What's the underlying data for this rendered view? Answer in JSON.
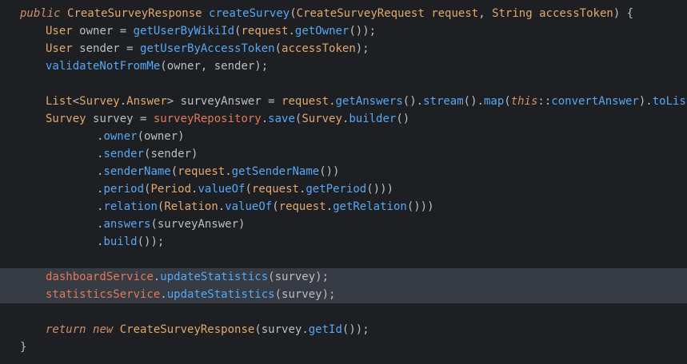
{
  "editor": {
    "lines": [
      {
        "segs": [
          [
            "public ",
            "kw"
          ],
          [
            "CreateSurveyResponse ",
            "cls"
          ],
          [
            "createSurvey",
            "fn"
          ],
          [
            "(",
            "var"
          ],
          [
            "CreateSurveyRequest ",
            "cls"
          ],
          [
            "request",
            "par"
          ],
          [
            ", ",
            "var"
          ],
          [
            "String ",
            "cls"
          ],
          [
            "accessToken",
            "par"
          ],
          [
            ") {",
            "var"
          ]
        ]
      },
      {
        "segs": [
          [
            "User ",
            "cls"
          ],
          [
            "owner = ",
            "var"
          ],
          [
            "getUserByWikiId",
            "fn"
          ],
          [
            "(",
            "var"
          ],
          [
            "request",
            "par"
          ],
          [
            ".",
            "var"
          ],
          [
            "getOwner",
            "fn"
          ],
          [
            "());",
            "var"
          ]
        ]
      },
      {
        "segs": [
          [
            "User ",
            "cls"
          ],
          [
            "sender = ",
            "var"
          ],
          [
            "getUserByAccessToken",
            "fn"
          ],
          [
            "(",
            "var"
          ],
          [
            "accessToken",
            "par"
          ],
          [
            ");",
            "var"
          ]
        ]
      },
      {
        "segs": [
          [
            "validateNotFromMe",
            "fn"
          ],
          [
            "(owner, sender);",
            "var"
          ]
        ]
      },
      {
        "segs": []
      },
      {
        "segs": [
          [
            "List",
            "cls"
          ],
          [
            "<",
            "var"
          ],
          [
            "Survey",
            "cls"
          ],
          [
            ".",
            "var"
          ],
          [
            "Answer",
            "cls"
          ],
          [
            "> surveyAnswer = ",
            "var"
          ],
          [
            "request",
            "par"
          ],
          [
            ".",
            "var"
          ],
          [
            "getAnswers",
            "fn"
          ],
          [
            "().",
            "var"
          ],
          [
            "stream",
            "fn"
          ],
          [
            "().",
            "var"
          ],
          [
            "map",
            "fn"
          ],
          [
            "(",
            "var"
          ],
          [
            "this",
            "this"
          ],
          [
            "::",
            "var"
          ],
          [
            "convertAnswer",
            "fn"
          ],
          [
            ").",
            "var"
          ],
          [
            "toList",
            "fn"
          ],
          [
            "();",
            "var"
          ]
        ]
      },
      {
        "segs": [
          [
            "Survey ",
            "cls"
          ],
          [
            "survey = ",
            "var"
          ],
          [
            "surveyRepository",
            "red"
          ],
          [
            ".",
            "var"
          ],
          [
            "save",
            "fn"
          ],
          [
            "(",
            "var"
          ],
          [
            "Survey",
            "cls"
          ],
          [
            ".",
            "var"
          ],
          [
            "builder",
            "fn"
          ],
          [
            "()",
            "var"
          ]
        ]
      },
      {
        "segs": [
          [
            ".",
            "var"
          ],
          [
            "owner",
            "fn"
          ],
          [
            "(owner)",
            "var"
          ]
        ]
      },
      {
        "segs": [
          [
            ".",
            "var"
          ],
          [
            "sender",
            "fn"
          ],
          [
            "(sender)",
            "var"
          ]
        ]
      },
      {
        "segs": [
          [
            ".",
            "var"
          ],
          [
            "senderName",
            "fn"
          ],
          [
            "(",
            "var"
          ],
          [
            "request",
            "par"
          ],
          [
            ".",
            "var"
          ],
          [
            "getSenderName",
            "fn"
          ],
          [
            "())",
            "var"
          ]
        ]
      },
      {
        "segs": [
          [
            ".",
            "var"
          ],
          [
            "period",
            "fn"
          ],
          [
            "(",
            "var"
          ],
          [
            "Period",
            "cls"
          ],
          [
            ".",
            "var"
          ],
          [
            "valueOf",
            "fn"
          ],
          [
            "(",
            "var"
          ],
          [
            "request",
            "par"
          ],
          [
            ".",
            "var"
          ],
          [
            "getPeriod",
            "fn"
          ],
          [
            "()))",
            "var"
          ]
        ]
      },
      {
        "segs": [
          [
            ".",
            "var"
          ],
          [
            "relation",
            "fn"
          ],
          [
            "(",
            "var"
          ],
          [
            "Relation",
            "cls"
          ],
          [
            ".",
            "var"
          ],
          [
            "valueOf",
            "fn"
          ],
          [
            "(",
            "var"
          ],
          [
            "request",
            "par"
          ],
          [
            ".",
            "var"
          ],
          [
            "getRelation",
            "fn"
          ],
          [
            "()))",
            "var"
          ]
        ]
      },
      {
        "segs": [
          [
            ".",
            "var"
          ],
          [
            "answers",
            "fn"
          ],
          [
            "(surveyAnswer)",
            "var"
          ]
        ]
      },
      {
        "segs": [
          [
            ".",
            "var"
          ],
          [
            "build",
            "fn"
          ],
          [
            "());",
            "var"
          ]
        ]
      },
      {
        "segs": []
      },
      {
        "segs": [
          [
            "dashboardService",
            "red"
          ],
          [
            ".",
            "var"
          ],
          [
            "updateStatistics",
            "fn"
          ],
          [
            "(survey);",
            "var"
          ]
        ]
      },
      {
        "segs": [
          [
            "statisticsService",
            "red"
          ],
          [
            ".",
            "var"
          ],
          [
            "updateStatistics",
            "fn"
          ],
          [
            "(survey);",
            "var"
          ]
        ]
      },
      {
        "segs": []
      },
      {
        "segs": [
          [
            "return ",
            "kw"
          ],
          [
            "new ",
            "kw"
          ],
          [
            "CreateSurveyResponse",
            "cls"
          ],
          [
            "(survey.",
            "var"
          ],
          [
            "getId",
            "fn"
          ],
          [
            "());",
            "var"
          ]
        ]
      },
      {
        "segs": [
          [
            "}",
            "var"
          ]
        ]
      }
    ]
  },
  "colors": {
    "background": "#1e1f22",
    "highlight": "#373b43",
    "keyword": "#cf8e6d",
    "method": "#56a8f5",
    "parameter": "#e0a96e",
    "field": "#e0795a"
  },
  "icons": {
    "gutter": "lightbulb-icon"
  }
}
